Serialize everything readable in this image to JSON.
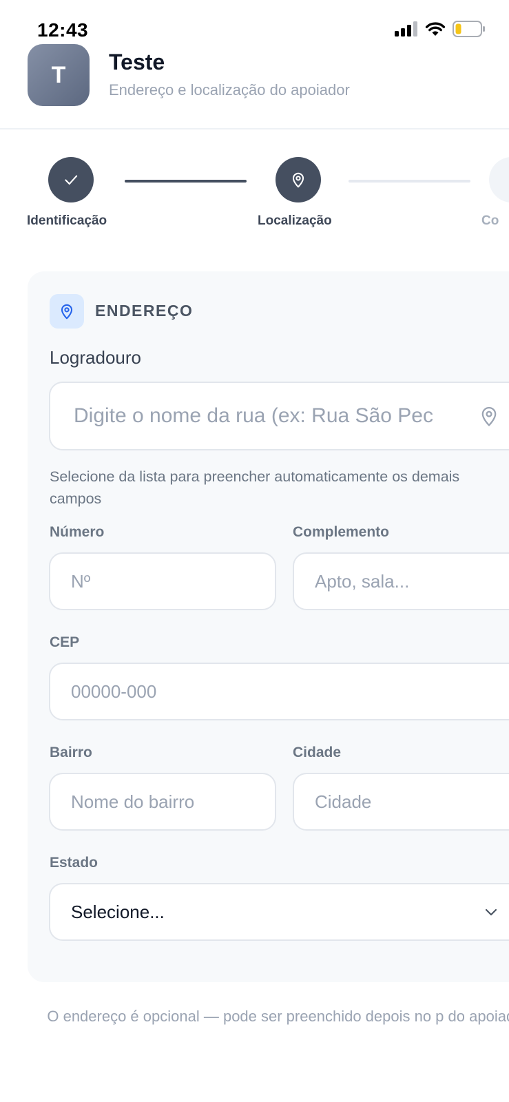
{
  "status_bar": {
    "time": "12:43",
    "icons": [
      "cellular-signal-icon",
      "wifi-icon",
      "battery-low-icon"
    ],
    "battery_color": "#f5c518"
  },
  "header": {
    "avatar_initial": "T",
    "title": "Teste",
    "subtitle": "Endereço e localização do apoiador"
  },
  "stepper": {
    "steps": [
      {
        "label": "Identificação",
        "state": "done",
        "icon": "check-icon"
      },
      {
        "label": "Localização",
        "state": "active",
        "icon": "map-pin-icon"
      },
      {
        "label": "Co",
        "state": "pending",
        "icon": ""
      }
    ]
  },
  "address_section": {
    "icon": "map-pin-icon",
    "title": "ENDEREÇO",
    "accent_color": "#2563eb",
    "street": {
      "label": "Logradouro",
      "placeholder": "Digite o nome da rua (ex: Rua São Pec",
      "icon": "map-pin-icon",
      "helper": "Selecione da lista para preencher automaticamente os demais campos"
    },
    "number": {
      "label": "Número",
      "placeholder": "Nº"
    },
    "complement": {
      "label": "Complemento",
      "placeholder": "Apto, sala..."
    },
    "cep": {
      "label": "CEP",
      "placeholder": "00000-000"
    },
    "neighborhood": {
      "label": "Bairro",
      "placeholder": "Nome do bairro"
    },
    "city": {
      "label": "Cidade",
      "placeholder": "Cidade"
    },
    "state": {
      "label": "Estado",
      "selected": "Selecione...",
      "icon": "chevron-down-icon"
    }
  },
  "footer_note": "O endereço é opcional — pode ser preenchido depois no p do apoiador."
}
